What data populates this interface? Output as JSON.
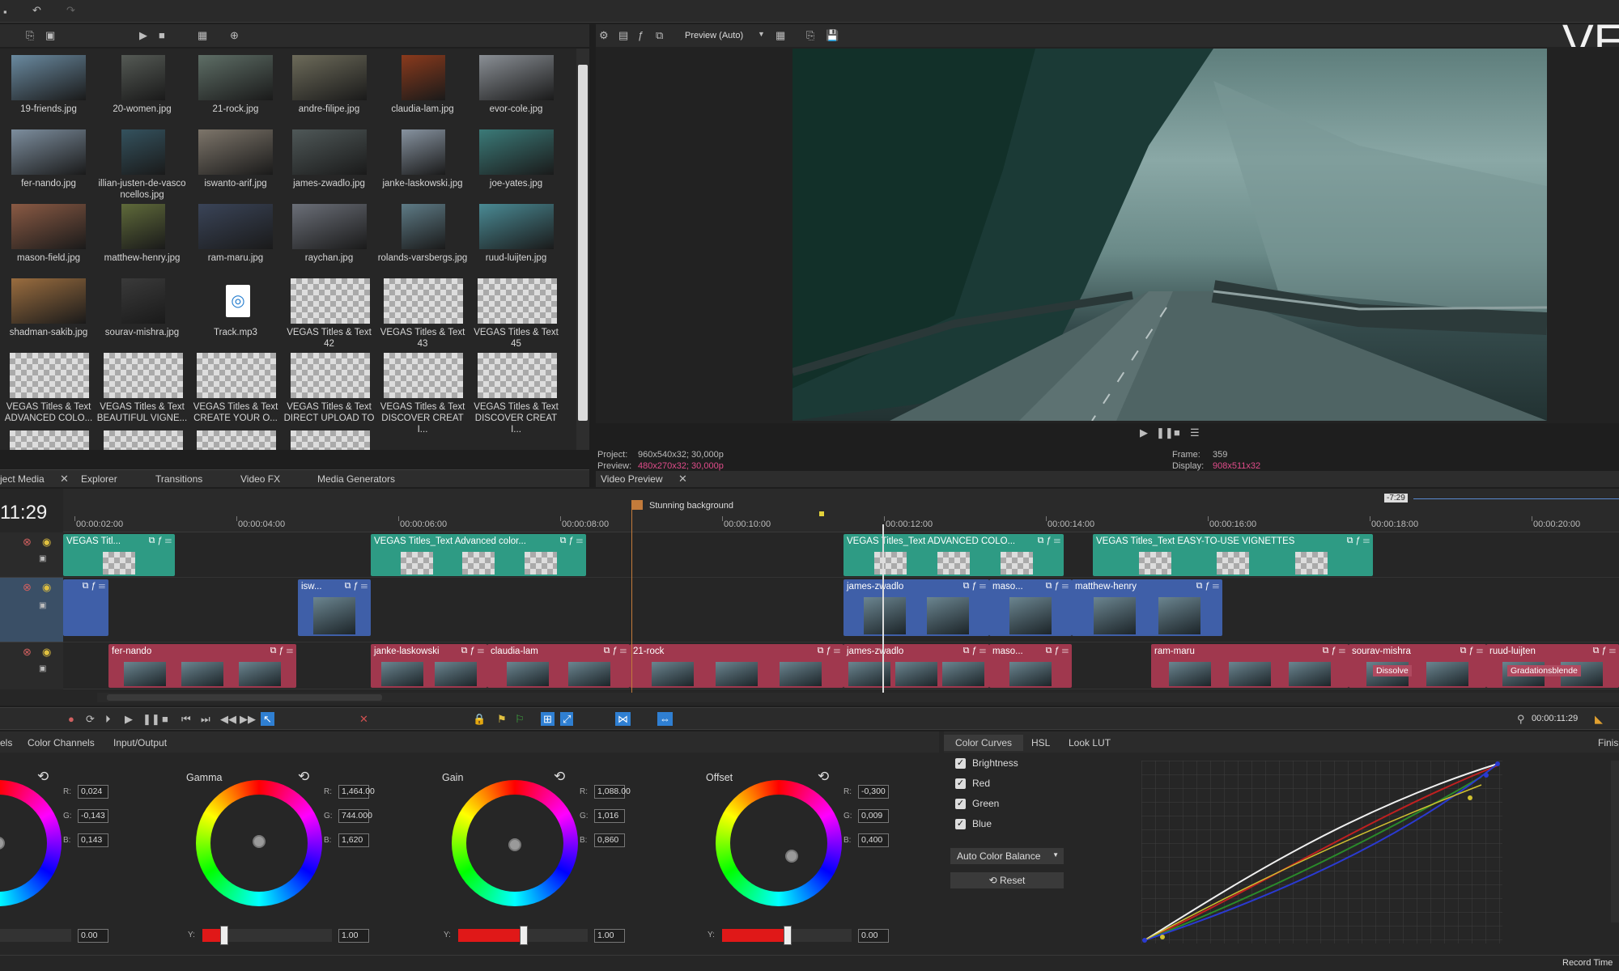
{
  "app": {
    "logo_text": "VE"
  },
  "media": {
    "items": [
      {
        "label": "19-friends.jpg",
        "kind": "photo",
        "color": "#6a8aa0"
      },
      {
        "label": "20-women.jpg",
        "kind": "photo",
        "color": "#555a55"
      },
      {
        "label": "21-rock.jpg",
        "kind": "photo",
        "color": "#5e6e66"
      },
      {
        "label": "andre-filipe.jpg",
        "kind": "photo",
        "color": "#6d6b5a"
      },
      {
        "label": "claudia-lam.jpg",
        "kind": "photo",
        "color": "#8a3a1c"
      },
      {
        "label": "evor-cole.jpg",
        "kind": "photo",
        "color": "#8a8f95"
      },
      {
        "label": "fer-nando.jpg",
        "kind": "photo",
        "color": "#7d8e9e"
      },
      {
        "label": "illian-justen-de-vasconcellos.jpg",
        "kind": "photo",
        "color": "#34525e"
      },
      {
        "label": "iswanto-arif.jpg",
        "kind": "photo",
        "color": "#7d756a"
      },
      {
        "label": "james-zwadlo.jpg",
        "kind": "photo",
        "color": "#4f5858"
      },
      {
        "label": "janke-laskowski.jpg",
        "kind": "photo",
        "color": "#8793a0"
      },
      {
        "label": "joe-yates.jpg",
        "kind": "photo",
        "color": "#3b7a78"
      },
      {
        "label": "mason-field.jpg",
        "kind": "photo",
        "color": "#8a5a44"
      },
      {
        "label": "matthew-henry.jpg",
        "kind": "photo",
        "color": "#5f6a3a"
      },
      {
        "label": "ram-maru.jpg",
        "kind": "photo",
        "color": "#3a4458"
      },
      {
        "label": "raychan.jpg",
        "kind": "photo",
        "color": "#6b6f78"
      },
      {
        "label": "rolands-varsbergs.jpg",
        "kind": "photo",
        "color": "#5e7b86"
      },
      {
        "label": "ruud-luijten.jpg",
        "kind": "photo",
        "color": "#4a8a94"
      },
      {
        "label": "shadman-sakib.jpg",
        "kind": "photo",
        "color": "#9a6d3f"
      },
      {
        "label": "sourav-mishra.jpg",
        "kind": "photo",
        "color": "#3a3a3a"
      },
      {
        "label": "Track.mp3",
        "kind": "audio",
        "color": "#ffffff"
      },
      {
        "label": "VEGAS Titles & Text 42",
        "kind": "checker",
        "color": ""
      },
      {
        "label": "VEGAS Titles & Text 43",
        "kind": "checker",
        "color": ""
      },
      {
        "label": "VEGAS Titles & Text 45",
        "kind": "checker",
        "color": ""
      },
      {
        "label": "VEGAS Titles & Text ADVANCED COLO...",
        "kind": "checker",
        "color": ""
      },
      {
        "label": "VEGAS Titles & Text BEAUTIFUL VIGNE...",
        "kind": "checker",
        "color": ""
      },
      {
        "label": "VEGAS Titles & Text CREATE YOUR O...",
        "kind": "checker",
        "color": ""
      },
      {
        "label": "VEGAS Titles & Text DIRECT UPLOAD TO",
        "kind": "checker",
        "color": ""
      },
      {
        "label": "VEGAS Titles & Text DISCOVER CREATI...",
        "kind": "checker",
        "color": ""
      },
      {
        "label": "VEGAS Titles & Text DISCOVER CREATI...",
        "kind": "checker",
        "color": ""
      }
    ],
    "tabs": [
      "ject Media",
      "Explorer",
      "Transitions",
      "Video FX",
      "Media Generators"
    ]
  },
  "preview": {
    "mode_label": "Preview (Auto)",
    "project_label": "Project:",
    "project_value": "960x540x32; 30,000p",
    "preview_label": "Preview:",
    "preview_value": "480x270x32; 30,000p",
    "frame_label": "Frame:",
    "frame_value": "359",
    "display_label": "Display:",
    "display_value": "908x511x32",
    "tab_label": "Video Preview"
  },
  "timeline": {
    "time_display": "11:29",
    "region_label": "Stunning background",
    "cursor_time": "-7:29",
    "ruler": [
      "00:00:02:00",
      "00:00:04:00",
      "00:00:06:00",
      "00:00:08:00",
      "00:00:10:00",
      "00:00:12:00",
      "00:00:14:00",
      "00:00:16:00",
      "00:00:18:00",
      "00:00:20:00"
    ],
    "track1": [
      "VEGAS Titl...",
      "VEGAS Titles_Text Advanced color...",
      "VEGAS Titles_Text ADVANCED COLO...",
      "VEGAS Titles_Text EASY-TO-USE VIGNETTES"
    ],
    "track2": [
      "isw...",
      "james-zwadlo",
      "maso...",
      "matthew-henry"
    ],
    "track3": [
      "fer-nando",
      "janke-laskowski",
      "claudia-lam",
      "21-rock",
      "james-zwadlo",
      "maso...",
      "ram-maru",
      "sourav-mishra",
      "ruud-luijten"
    ],
    "transitions": [
      "Dissolve",
      "Gradationsblende"
    ],
    "end_time": "00:00:11:29"
  },
  "color": {
    "tabs_left": [
      "els",
      "Color Channels",
      "Input/Output"
    ],
    "wheels": [
      {
        "title": "",
        "r": "0,024",
        "g": "-0,143",
        "b": "0,143",
        "y": "0.00"
      },
      {
        "title": "Gamma",
        "r": "1,464.00",
        "g": "744.000",
        "b": "1,620",
        "y": "1.00"
      },
      {
        "title": "Gain",
        "r": "1,088.00",
        "g": "1,016",
        "b": "0,860",
        "y": "1.00"
      },
      {
        "title": "Offset",
        "r": "-0,300",
        "g": "0,009",
        "b": "0,400",
        "y": "0.00"
      }
    ],
    "tabs_right": [
      "Color Curves",
      "HSL",
      "Look LUT"
    ],
    "finish": "Finish",
    "checks": [
      "Brightness",
      "Red",
      "Green",
      "Blue"
    ],
    "auto_balance": "Auto Color Balance",
    "reset": "Reset",
    "record_time": "Record Time",
    "r_lbl": "R:",
    "g_lbl": "G:",
    "b_lbl": "B:",
    "y_lbl": "Y:"
  }
}
